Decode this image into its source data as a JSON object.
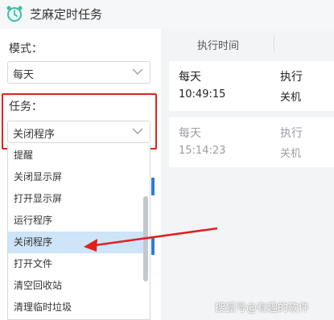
{
  "window": {
    "title": "芝麻定时任务",
    "icon": "alarm-clock-icon"
  },
  "form": {
    "mode_label": "模式：",
    "mode_value": "每天",
    "task_label": "任务：",
    "task_value": "关闭程序"
  },
  "dropdown": {
    "items": [
      "提醒",
      "关闭显示屏",
      "打开显示屏",
      "运行程序",
      "关闭程序",
      "打开文件",
      "清空回收站",
      "清理临时垃圾"
    ],
    "selected": "关闭程序"
  },
  "table": {
    "header": "执行时间",
    "rows": [
      {
        "frequency": "每天",
        "time": "10:49:15",
        "action": "执行",
        "target": "关机",
        "state": "active"
      },
      {
        "frequency": "每天",
        "time": "15:14:23",
        "action": "执行",
        "target": "关机",
        "state": "inactive"
      }
    ]
  },
  "colors": {
    "highlight": "#e02020",
    "accent": "#2f7bd6",
    "selected_bg": "#cde4f9"
  },
  "watermark": "搜狐号@有趣的软件"
}
